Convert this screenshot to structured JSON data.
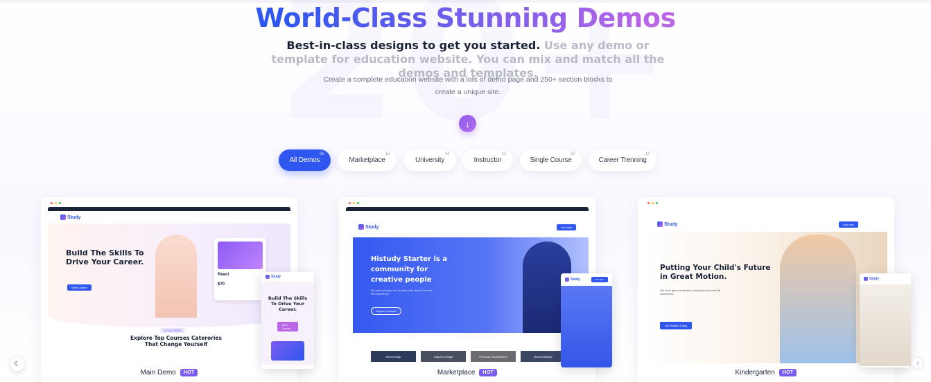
{
  "section": {
    "bg_number": "20+",
    "title": "World-Class Stunning Demos",
    "subtitle_dark": "Best-in-class designs to get you started.",
    "subtitle_light": "Use any demo or template for education website. You can mix and match all the demos and templates.",
    "description": "Create a complete education website with a lots of demo page and 250+ section blocks to create a unique site."
  },
  "filters": [
    {
      "label": "All Demos",
      "count": "26",
      "active": true
    },
    {
      "label": "Marketplace",
      "count": "13",
      "active": false
    },
    {
      "label": "University",
      "count": "14",
      "active": false
    },
    {
      "label": "Instructor",
      "count": "12",
      "active": false
    },
    {
      "label": "Single Course",
      "count": "22",
      "active": false
    },
    {
      "label": "Career Trenning",
      "count": "13",
      "active": false
    }
  ],
  "demos": [
    {
      "label": "Main Demo",
      "badge": "HOT",
      "logo": "Study",
      "hero": "Build The Skills To Drive Your Career.",
      "section_tag": "CATEGORIES",
      "section_title": "Explore Top Courses Caterories That Change Yourself",
      "cta": "View Course",
      "course_card_title": "React",
      "price": "$70",
      "phone_hero": "Build The Skills To Drive Your Career."
    },
    {
      "label": "Marketplace",
      "badge": "HOT",
      "logo": "Study",
      "hero": "Histudy Starter is a community for creative people",
      "hero_sub": "We just don't give our student only lecture but real life experience.",
      "cta": "Explore Courses",
      "join": "Join Now",
      "categories": [
        "Web Design",
        "Graphic Design",
        "Personal Development",
        "Good Software"
      ]
    },
    {
      "label": "Kindergarten",
      "badge": "HOT",
      "logo": "Study",
      "hero": "Putting Your Child's Future in Great Motion.",
      "hero_sub": "We don't give our student only lecture but real life experience.",
      "cta": "Get Started Today",
      "join": "Join Now"
    }
  ],
  "colors": {
    "primary": "#2f57ef",
    "secondary": "#b966e7",
    "hot_badge": "#7b5cf0"
  },
  "icons": {
    "scroll_down": "arrow-down-icon",
    "theme": "moon-icon",
    "back_to_top": "arrow-up-icon"
  }
}
